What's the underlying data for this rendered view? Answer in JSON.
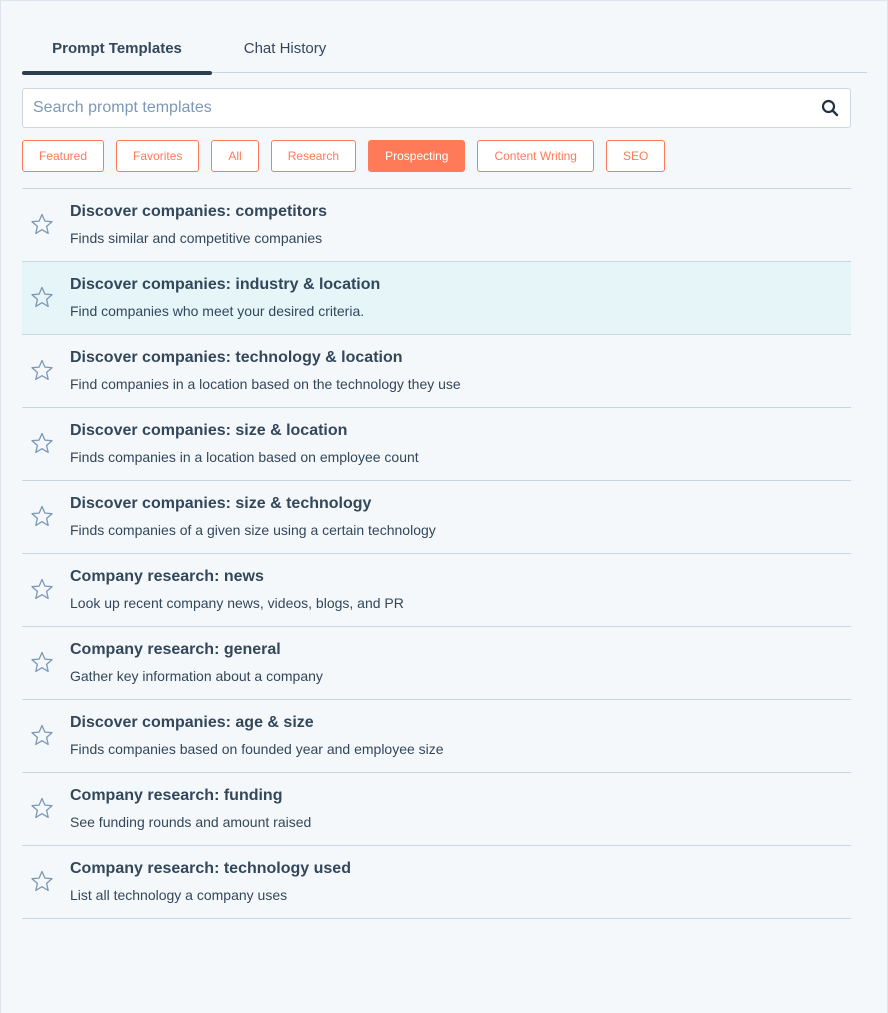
{
  "tabs": [
    {
      "label": "Prompt Templates",
      "active": true
    },
    {
      "label": "Chat History",
      "active": false
    }
  ],
  "search": {
    "placeholder": "Search prompt templates",
    "value": "",
    "icon": "search-icon"
  },
  "filters": [
    {
      "label": "Featured",
      "selected": false
    },
    {
      "label": "Favorites",
      "selected": false
    },
    {
      "label": "All",
      "selected": false
    },
    {
      "label": "Research",
      "selected": false
    },
    {
      "label": "Prospecting",
      "selected": true
    },
    {
      "label": "Content Writing",
      "selected": false
    },
    {
      "label": "SEO",
      "selected": false
    }
  ],
  "colors": {
    "accent": "#ff7a59",
    "text": "#33475b",
    "highlight_row": "#e5f5f8",
    "background": "#f5f8fa"
  },
  "templates": [
    {
      "title": "Discover companies: competitors",
      "description": "Finds similar and competitive companies",
      "favorite": false,
      "highlighted": false
    },
    {
      "title": "Discover companies: industry & location",
      "description": "Find companies who meet your desired criteria.",
      "favorite": false,
      "highlighted": true
    },
    {
      "title": "Discover companies: technology & location",
      "description": "Find companies in a location based on the technology they use",
      "favorite": false,
      "highlighted": false
    },
    {
      "title": "Discover companies: size & location",
      "description": "Finds companies in a location based on employee count",
      "favorite": false,
      "highlighted": false
    },
    {
      "title": "Discover companies: size & technology",
      "description": "Finds companies of a given size using a certain technology",
      "favorite": false,
      "highlighted": false
    },
    {
      "title": "Company research: news",
      "description": "Look up recent company news, videos, blogs, and PR",
      "favorite": false,
      "highlighted": false
    },
    {
      "title": "Company research: general",
      "description": "Gather key information about a company",
      "favorite": false,
      "highlighted": false
    },
    {
      "title": "Discover companies: age & size",
      "description": "Finds companies based on founded year and employee size",
      "favorite": false,
      "highlighted": false
    },
    {
      "title": "Company research: funding",
      "description": "See funding rounds and amount raised",
      "favorite": false,
      "highlighted": false
    },
    {
      "title": "Company research: technology used",
      "description": "List all technology a company uses",
      "favorite": false,
      "highlighted": false
    }
  ]
}
